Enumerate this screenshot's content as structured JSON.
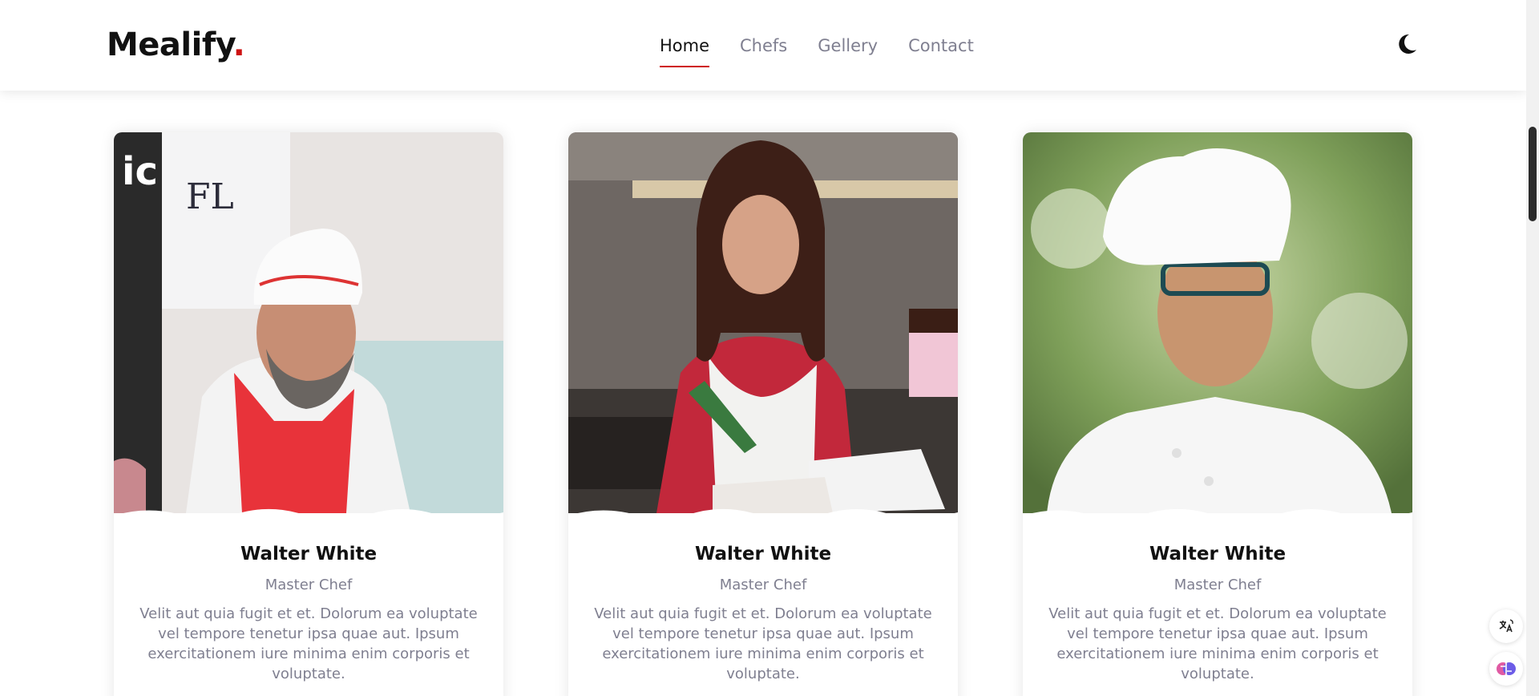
{
  "brand": {
    "name": "Mealify",
    "dot": "."
  },
  "nav": {
    "items": [
      {
        "label": "Home",
        "active": true
      },
      {
        "label": "Chefs",
        "active": false
      },
      {
        "label": "Gellery",
        "active": false
      },
      {
        "label": "Contact",
        "active": false
      }
    ]
  },
  "theme_toggle": {
    "icon": "moon-icon"
  },
  "chefs": [
    {
      "name": "Walter White",
      "role": "Master Chef",
      "description": "Velit aut quia fugit et et. Dolorum ea voluptate vel tempore tenetur ipsa quae aut. Ipsum exercitationem iure minima enim corporis et voluptate."
    },
    {
      "name": "Walter White",
      "role": "Master Chef",
      "description": "Velit aut quia fugit et et. Dolorum ea voluptate vel tempore tenetur ipsa quae aut. Ipsum exercitationem iure minima enim corporis et voluptate."
    },
    {
      "name": "Walter White",
      "role": "Master Chef",
      "description": "Velit aut quia fugit et et. Dolorum ea voluptate vel tempore tenetur ipsa quae aut. Ipsum exercitationem iure minima enim corporis et voluptate."
    }
  ],
  "colors": {
    "accent": "#ce1212",
    "muted_text": "#7f7f90",
    "heading": "#111111"
  },
  "floating_widgets": [
    "translate-icon",
    "brain-icon"
  ]
}
